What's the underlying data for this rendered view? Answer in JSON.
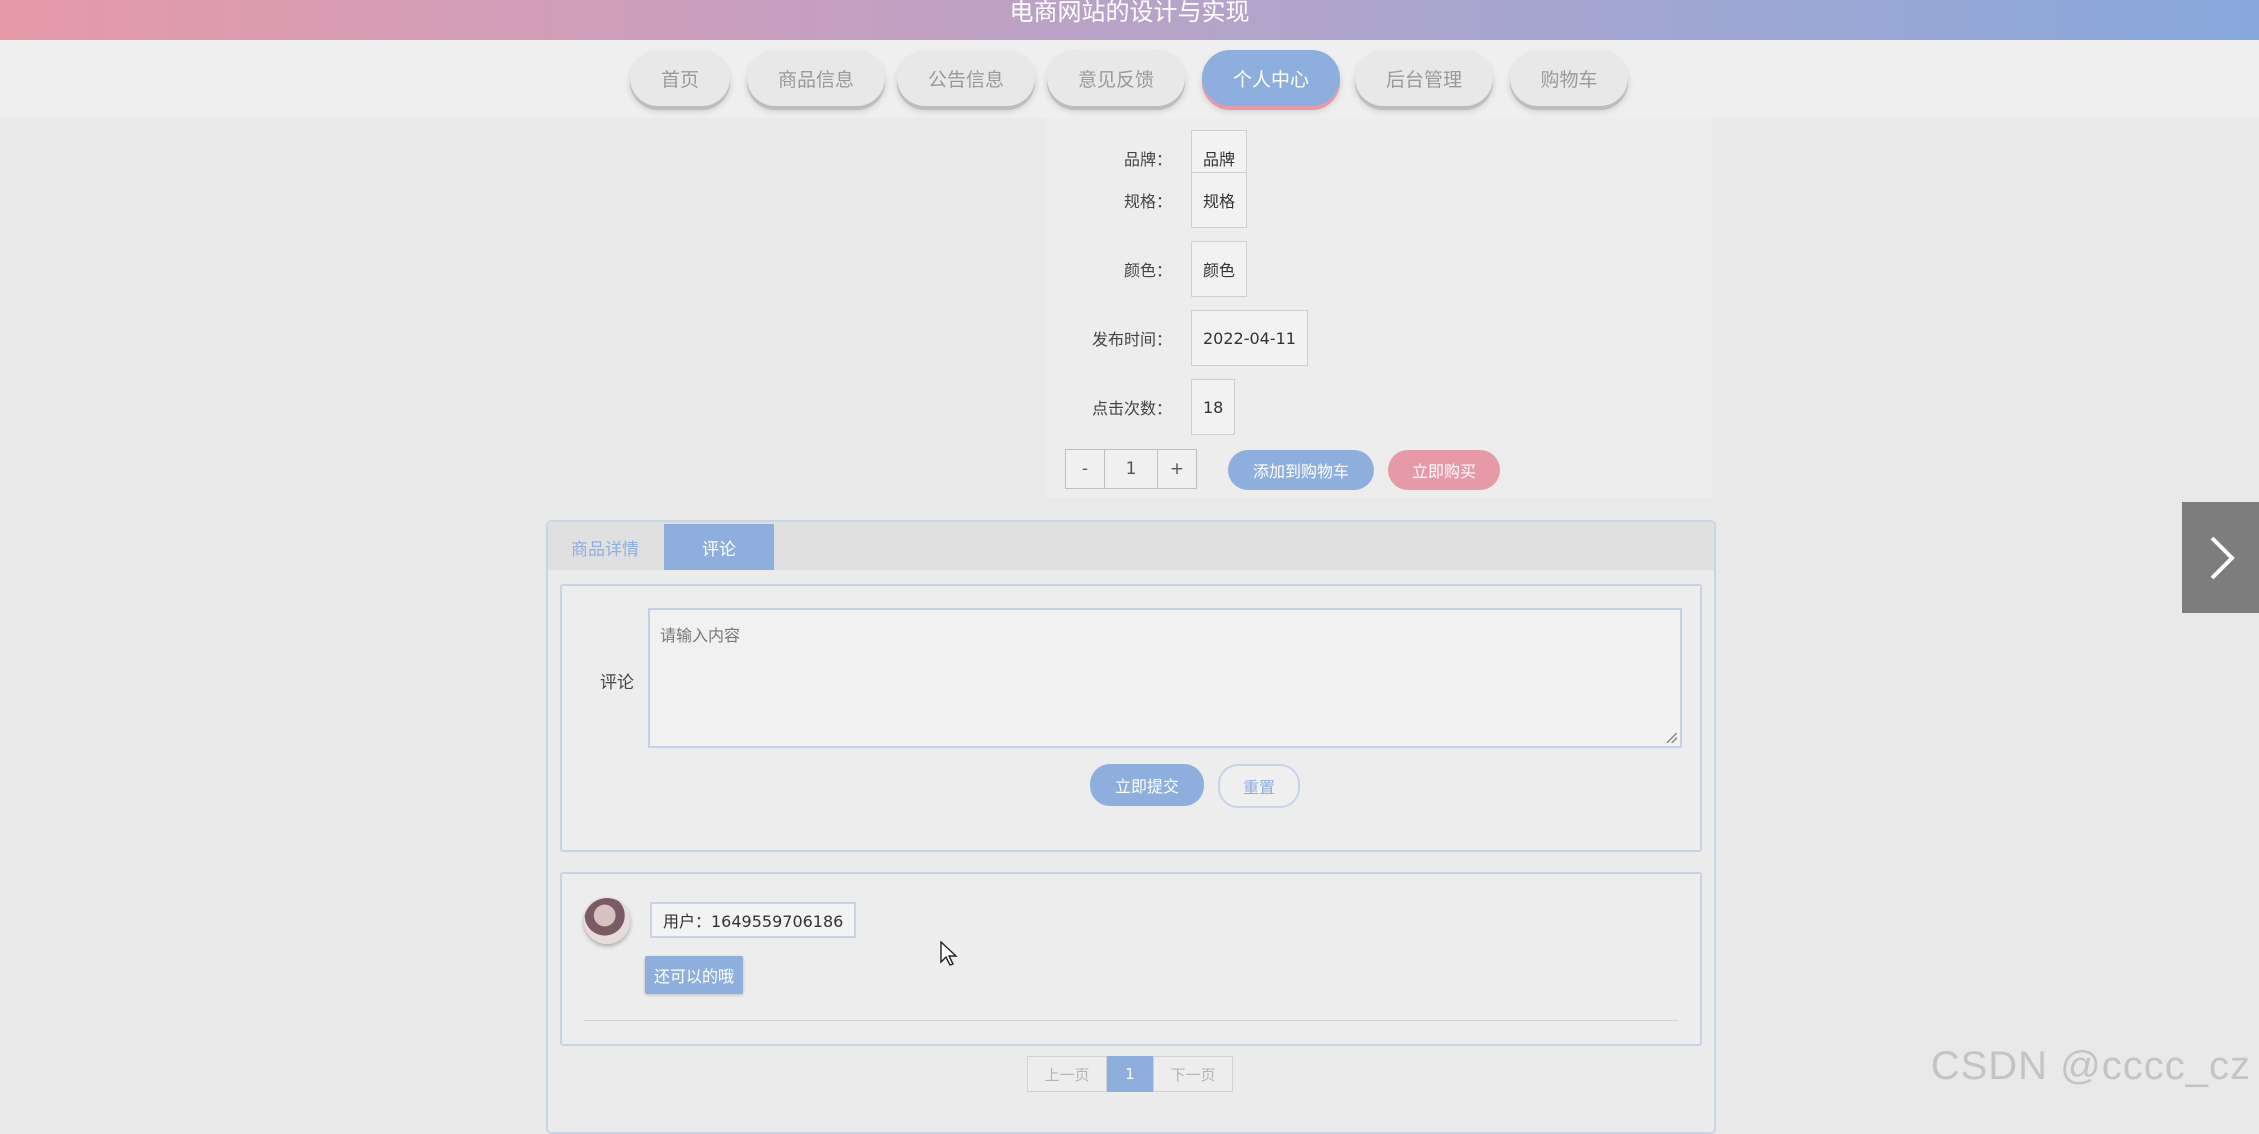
{
  "header": {
    "title": "电商网站的设计与实现"
  },
  "nav": {
    "items": [
      {
        "label": "首页"
      },
      {
        "label": "商品信息"
      },
      {
        "label": "公告信息"
      },
      {
        "label": "意见反馈"
      },
      {
        "label": "个人中心",
        "active": true
      },
      {
        "label": "后台管理"
      },
      {
        "label": "购物车"
      }
    ]
  },
  "product": {
    "rows": [
      {
        "label": "品牌：",
        "value": "品牌"
      },
      {
        "label": "规格：",
        "value": "规格"
      },
      {
        "label": "颜色：",
        "value": "颜色"
      },
      {
        "label": "发布时间：",
        "value": "2022-04-11"
      },
      {
        "label": "点击次数：",
        "value": "18"
      }
    ],
    "quantity": {
      "minus": "-",
      "value": "1",
      "plus": "+"
    },
    "add_to_cart": "添加到购物车",
    "buy_now": "立即购买"
  },
  "tabs": [
    {
      "label": "商品详情"
    },
    {
      "label": "评论",
      "active": true
    }
  ],
  "comment_form": {
    "label": "评论",
    "placeholder": "请输入内容",
    "submit": "立即提交",
    "reset": "重置"
  },
  "comments": [
    {
      "user": "用户：1649559706186",
      "reply": "还可以的哦"
    }
  ],
  "pager": {
    "prev": "上一页",
    "current": "1",
    "next": "下一页"
  },
  "watermark": "CSDN @cccc_cz",
  "colors": {
    "accent": "#8eafdd",
    "pink": "#e69aa8"
  }
}
